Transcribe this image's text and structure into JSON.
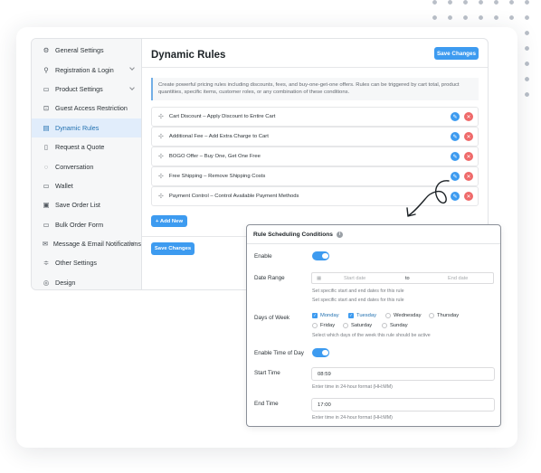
{
  "sidebar": {
    "items": [
      {
        "label": "General Settings",
        "icon": "gear-icon",
        "glyph": "⚙"
      },
      {
        "label": "Registration & Login",
        "icon": "user-icon",
        "glyph": "⚲"
      },
      {
        "label": "Product Settings",
        "icon": "box-icon",
        "glyph": "▭"
      },
      {
        "label": "Guest Access Restriction",
        "icon": "lock-icon",
        "glyph": "⊡"
      },
      {
        "label": "Dynamic Rules",
        "icon": "rules-icon",
        "glyph": "▤"
      },
      {
        "label": "Request a Quote",
        "icon": "document-icon",
        "glyph": "▯"
      },
      {
        "label": "Conversation",
        "icon": "chat-icon",
        "glyph": "◌"
      },
      {
        "label": "Wallet",
        "icon": "wallet-icon",
        "glyph": "▭"
      },
      {
        "label": "Save Order List",
        "icon": "save-icon",
        "glyph": "▣"
      },
      {
        "label": "Bulk Order Form",
        "icon": "cart-icon",
        "glyph": "▭"
      },
      {
        "label": "Message & Email Notifications",
        "icon": "mail-icon",
        "glyph": "✉"
      },
      {
        "label": "Other Settings",
        "icon": "sliders-icon",
        "glyph": "≑"
      },
      {
        "label": "Design",
        "icon": "palette-icon",
        "glyph": "◎"
      }
    ]
  },
  "main": {
    "title": "Dynamic Rules",
    "save_label": "Save Changes",
    "notice": "Create powerful pricing rules including discounts, fees, and buy-one-get-one offers. Rules can be triggered by cart total, product quantities, specific items, customer roles, or any combination of these conditions.",
    "rules": [
      "Cart Discount – Apply Discount to Entire Cart",
      "Additional Fee – Add Extra Charge to Cart",
      "BOGO Offer – Buy One, Get One Free",
      "Free Shipping – Remove Shipping Costs",
      "Payment Control – Control Available Payment Methods"
    ],
    "add_new_label": "+ Add New",
    "save_bottom_label": "Save Changes"
  },
  "modal": {
    "title": "Rule Scheduling Conditions",
    "enable_label": "Enable",
    "date_range_label": "Date Range",
    "start_date_placeholder": "Start date",
    "to_label": "to",
    "end_date_placeholder": "End date",
    "date_help_1": "Set specific start and end dates for this rule",
    "date_help_2": "Set specific start and end dates for this rule",
    "days_label": "Days of Week",
    "days": [
      {
        "label": "Monday",
        "checked": true
      },
      {
        "label": "Tuesday",
        "checked": true
      },
      {
        "label": "Wednesday",
        "checked": false
      },
      {
        "label": "Thursday",
        "checked": false
      },
      {
        "label": "Friday",
        "checked": false
      },
      {
        "label": "Saturday",
        "checked": false
      },
      {
        "label": "Sunday",
        "checked": false
      }
    ],
    "days_help": "Select which days of the week this rule should be active",
    "time_of_day_label": "Enable Time of Day",
    "start_time_label": "Start Time",
    "start_time_value": "08:59",
    "start_time_help": "Enter time in 24-hour format (HH:MM)",
    "end_time_label": "End Time",
    "end_time_value": "17:00",
    "end_time_help": "Enter time in 24-hour format (HH:MM)"
  },
  "colors": {
    "accent": "#3d9bf0",
    "danger": "#ef6a6a",
    "active_bg": "#e1edfb"
  }
}
